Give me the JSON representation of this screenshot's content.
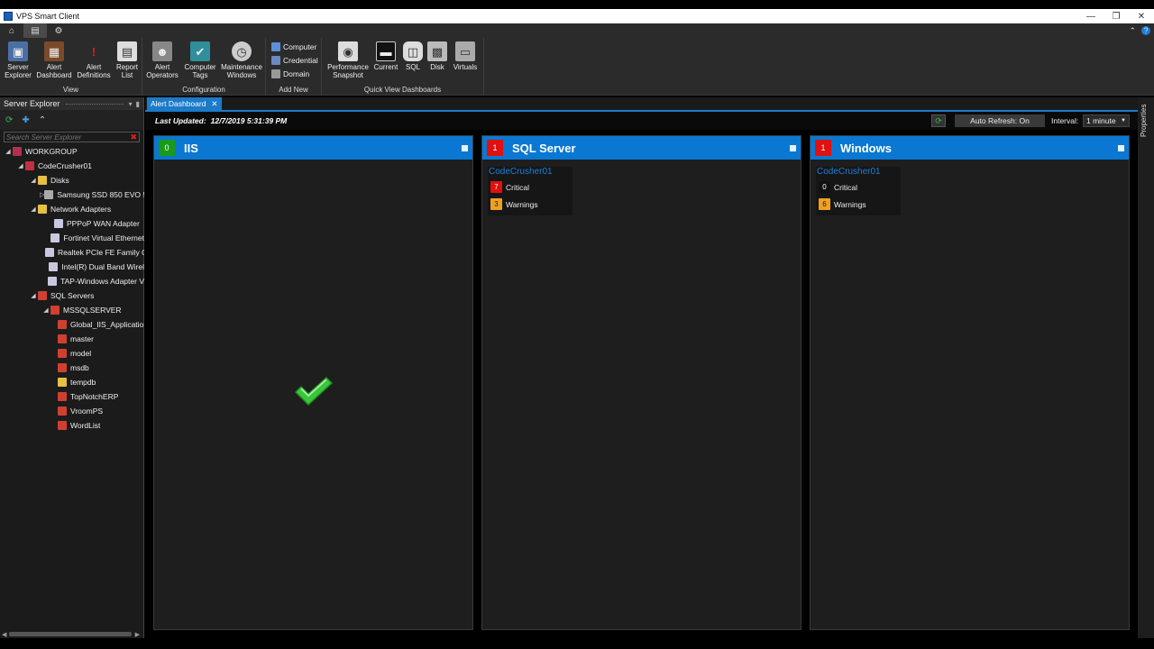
{
  "window": {
    "title": "VPS Smart Client"
  },
  "ribbon": {
    "groups": [
      {
        "label": "View",
        "buttons": [
          {
            "line1": "Server",
            "line2": "Explorer"
          },
          {
            "line1": "Alert",
            "line2": "Dashboard"
          },
          {
            "line1": "Alert",
            "line2": "Definitions"
          },
          {
            "line1": "Report",
            "line2": "List"
          }
        ]
      },
      {
        "label": "Configuration",
        "buttons": [
          {
            "line1": "Alert",
            "line2": "Operators"
          },
          {
            "line1": "Computer",
            "line2": "Tags"
          },
          {
            "line1": "Maintenance",
            "line2": "Windows"
          }
        ]
      },
      {
        "label": "Add New",
        "items": [
          "Computer",
          "Credential",
          "Domain"
        ]
      },
      {
        "label": "Quick View Dashboards",
        "buttons": [
          {
            "line1": "Performance",
            "line2": "Snapshot"
          },
          {
            "line1": "Current",
            "line2": ""
          },
          {
            "line1": "SQL",
            "line2": ""
          },
          {
            "line1": "Disk",
            "line2": ""
          },
          {
            "line1": "Virtuals",
            "line2": ""
          }
        ]
      }
    ]
  },
  "explorer": {
    "title": "Server Explorer",
    "search_placeholder": "Search Server Explorer",
    "tree": [
      "WORKGROUP",
      "CodeCrusher01",
      "Disks",
      "Samsung SSD 850 EVO 5",
      "Network Adapters",
      "PPPoP WAN Adapter",
      "Fortinet Virtual Ethernet",
      "Realtek PCIe FE Family C",
      "Intel(R) Dual Band Wirel",
      "TAP-Windows Adapter V",
      "SQL Servers",
      "MSSQLSERVER",
      "Global_IIS_Applicatio",
      "master",
      "model",
      "msdb",
      "tempdb",
      "TopNotchERP",
      "VroomPS",
      "WordList"
    ]
  },
  "document": {
    "tab_label": "Alert Dashboard",
    "last_updated_label": "Last Updated:",
    "last_updated_value": "12/7/2019 5:31:39 PM",
    "auto_refresh": "Auto Refresh: On",
    "interval_label": "Interval:",
    "interval_value": "1 minute"
  },
  "panels": [
    {
      "title": "IIS",
      "count": "0",
      "count_color": "#1a9a1a"
    },
    {
      "title": "SQL Server",
      "count": "1",
      "count_color": "#e01010",
      "server": "CodeCrusher01",
      "critical_count": "7",
      "critical_label": "Critical",
      "warnings_count": "3",
      "warnings_label": "Warnings"
    },
    {
      "title": "Windows",
      "count": "1",
      "count_color": "#e01010",
      "server": "CodeCrusher01",
      "critical_count": "0",
      "critical_label": "Critical",
      "warnings_count": "6",
      "warnings_label": "Warnings"
    }
  ],
  "properties_label": "Properties",
  "colors": {
    "accent": "#0a78d2",
    "critical": "#e01010",
    "warning": "#f0a020",
    "ok": "#1a9a1a"
  }
}
